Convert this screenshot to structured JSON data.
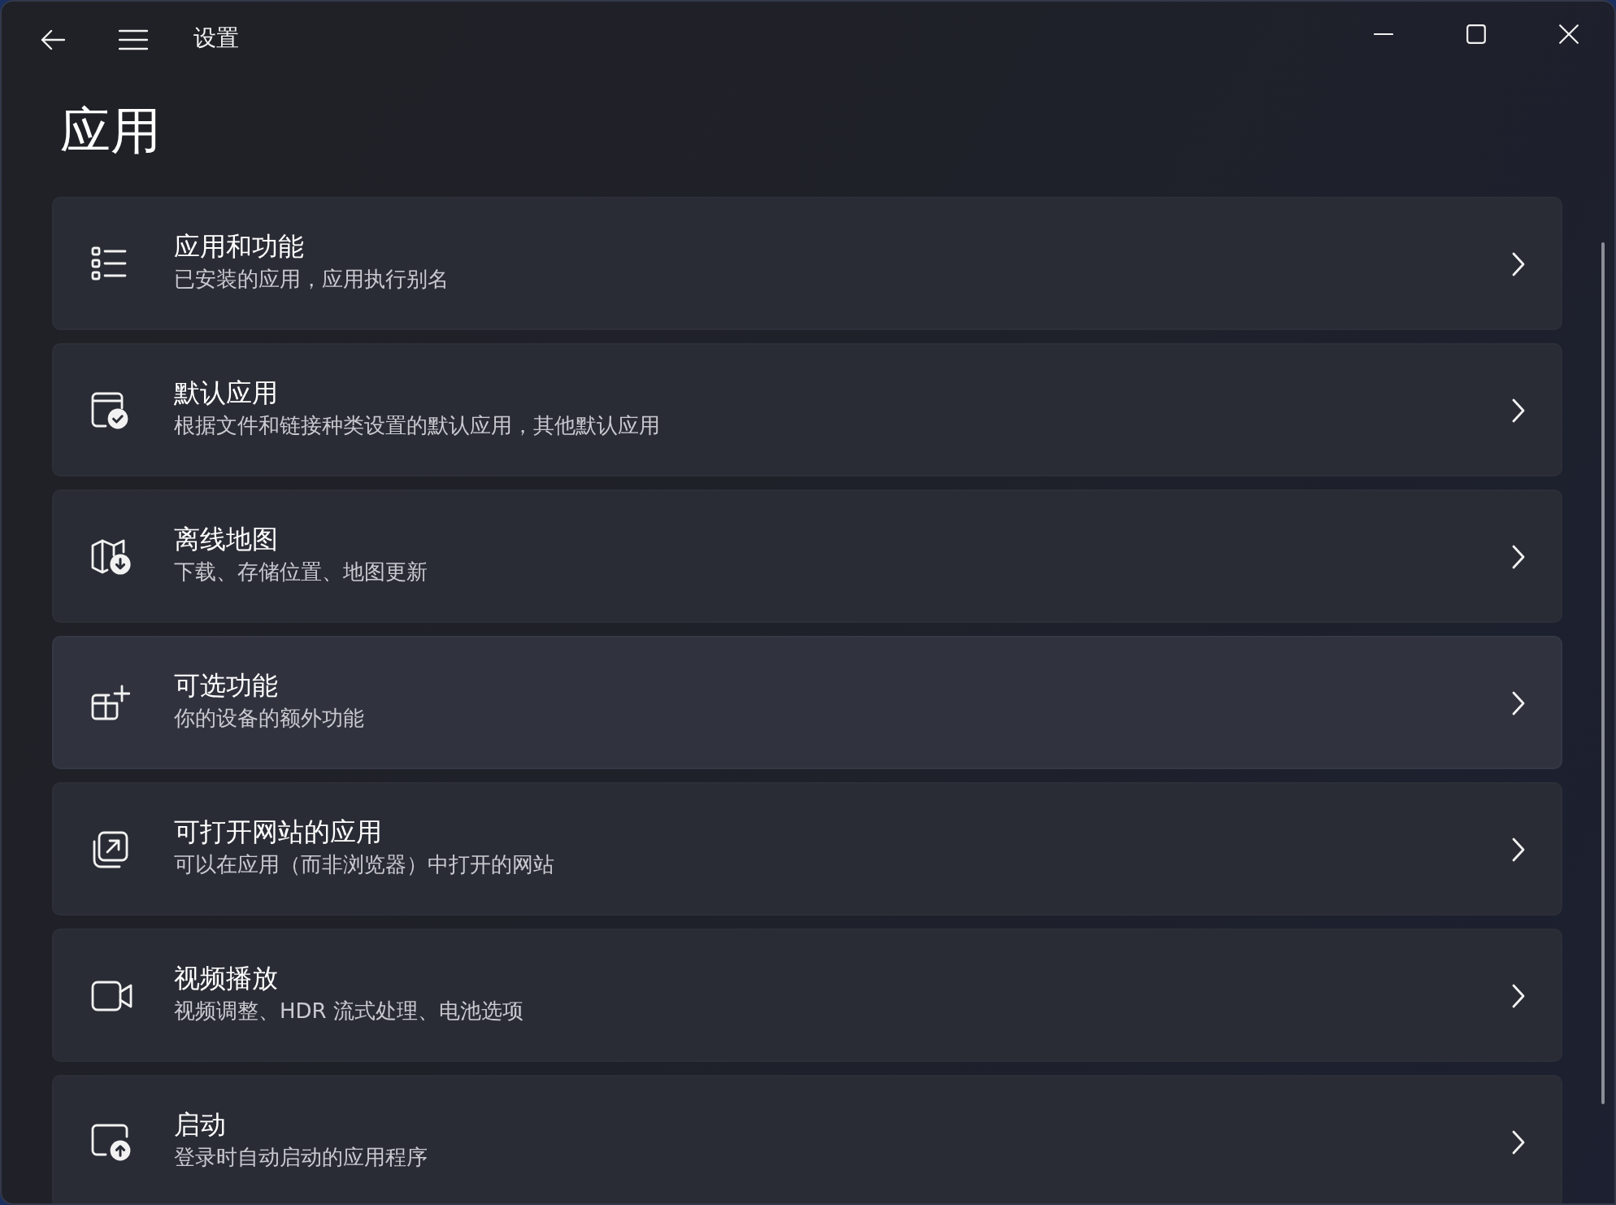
{
  "window": {
    "title": "设置"
  },
  "page": {
    "heading": "应用"
  },
  "items": [
    {
      "title": "应用和功能",
      "subtitle": "已安装的应用，应用执行别名",
      "hovered": false
    },
    {
      "title": "默认应用",
      "subtitle": "根据文件和链接种类设置的默认应用，其他默认应用",
      "hovered": false
    },
    {
      "title": "离线地图",
      "subtitle": "下载、存储位置、地图更新",
      "hovered": false
    },
    {
      "title": "可选功能",
      "subtitle": "你的设备的额外功能",
      "hovered": true
    },
    {
      "title": "可打开网站的应用",
      "subtitle": "可以在应用（而非浏览器）中打开的网站",
      "hovered": false
    },
    {
      "title": "视频播放",
      "subtitle": "视频调整、HDR 流式处理、电池选项",
      "hovered": false
    },
    {
      "title": "启动",
      "subtitle": "登录时自动启动的应用程序",
      "hovered": false
    }
  ]
}
